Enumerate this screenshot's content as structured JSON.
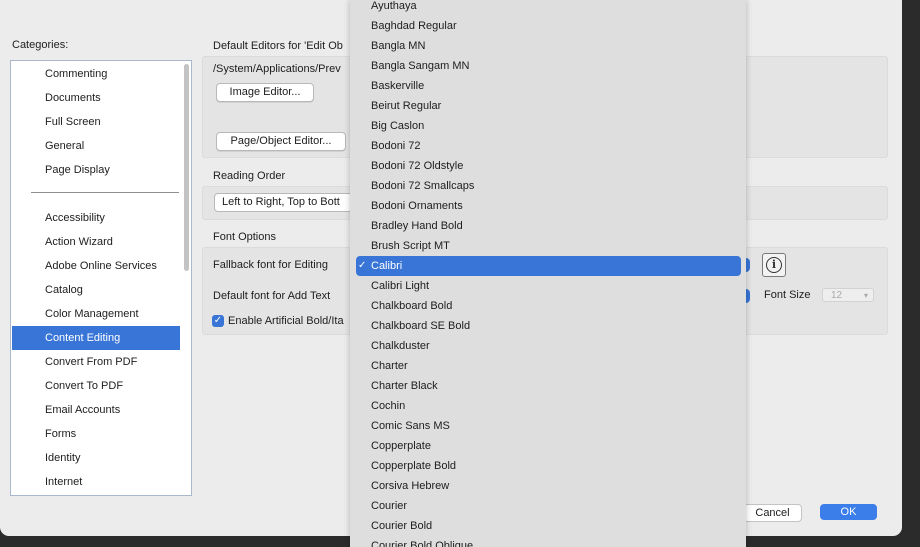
{
  "categories": {
    "label": "Categories:",
    "group1": [
      "Commenting",
      "Documents",
      "Full Screen",
      "General",
      "Page Display"
    ],
    "group2": [
      "Accessibility",
      "Action Wizard",
      "Adobe Online Services",
      "Catalog",
      "Color Management",
      "Content Editing",
      "Convert From PDF",
      "Convert To PDF",
      "Email Accounts",
      "Forms",
      "Identity",
      "Internet"
    ],
    "selected": "Content Editing"
  },
  "default_editors": {
    "title": "Default Editors for 'Edit Ob",
    "path": "/System/Applications/Prev",
    "image_editor_button": "Image Editor...",
    "page_object_editor_button": "Page/Object Editor..."
  },
  "reading_order": {
    "title": "Reading Order",
    "value": "Left to Right, Top to Bott"
  },
  "font_options": {
    "title": "Font Options",
    "fallback_label": "Fallback font for Editing",
    "default_font_label": "Default font for Add Text",
    "artificial_bold_label": "Enable Artificial Bold/Ita",
    "font_size_label": "Font Size",
    "font_size_value": "12"
  },
  "buttons": {
    "cancel": "Cancel",
    "ok": "OK"
  },
  "font_dropdown": {
    "selected": "Calibri",
    "check_mark": "✓",
    "options": [
      "Ayuthaya",
      "Baghdad Regular",
      "Bangla MN",
      "Bangla Sangam MN",
      "Baskerville",
      "Beirut Regular",
      "Big Caslon",
      "Bodoni 72",
      "Bodoni 72 Oldstyle",
      "Bodoni 72 Smallcaps",
      "Bodoni Ornaments",
      "Bradley Hand Bold",
      "Brush Script MT",
      "Calibri",
      "Calibri Light",
      "Chalkboard Bold",
      "Chalkboard SE Bold",
      "Chalkduster",
      "Charter",
      "Charter Black",
      "Cochin",
      "Comic Sans MS",
      "Copperplate",
      "Copperplate Bold",
      "Corsiva Hebrew",
      "Courier",
      "Courier Bold",
      "Courier Bold Oblique"
    ]
  },
  "colors": {
    "accent": "#3875d7",
    "ok_button": "#3b7eea",
    "window_bg": "#ececec",
    "menu_bg": "#dedede"
  }
}
